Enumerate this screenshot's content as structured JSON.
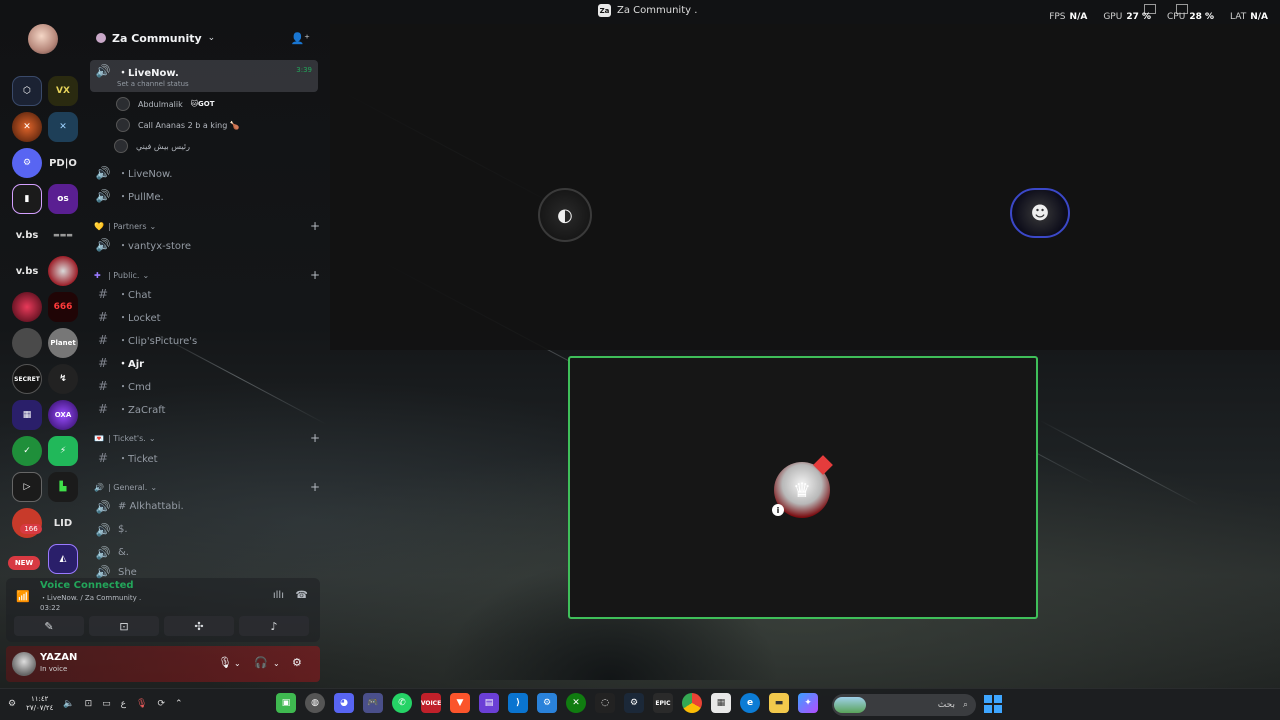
{
  "window": {
    "title": "Za Community .",
    "perf": [
      {
        "label": "FPS",
        "value": "N/A"
      },
      {
        "label": "GPU",
        "value": "27 %"
      },
      {
        "label": "CPU",
        "value": "28 %"
      },
      {
        "label": "LAT",
        "value": "N/A"
      }
    ]
  },
  "rail": {
    "new_badge": "NEW",
    "text_servers": [
      "PD|O",
      "v.bs",
      "v.bs",
      "LID"
    ],
    "badge_166": "166"
  },
  "server": {
    "name": "Za Community"
  },
  "channels": {
    "live_active": {
      "name": "・LiveNow.",
      "timer": "3:39",
      "status": "Set a channel status"
    },
    "voice_users": [
      {
        "name": "Abdulmalik",
        "tag": "🐱GOT"
      },
      {
        "name": "Call Ananas 2 b a king 🍗",
        "tag": ""
      },
      {
        "name": "رئيس بيش فيني",
        "tag": ""
      }
    ],
    "live2": "・LiveNow.",
    "pullme": "・PullMe.",
    "cat_partners": "| Partners",
    "vantyx": "・vantyx-store",
    "cat_public": "| Public.",
    "chat": "・Chat",
    "locket": "・Locket",
    "clips": "・Clip'sPicture's",
    "ajr": "・Ajr",
    "cmd": "・Cmd",
    "zacraft": "・ZaCraft",
    "cat_tickets": "| Ticket's.",
    "ticket": "・Ticket",
    "cat_general": "| General.",
    "alkhattabi": "# Alkhattabi.",
    "dollar": "$.",
    "amp": "&.",
    "she": "She"
  },
  "voice": {
    "title": "Voice Connected",
    "location": "・LiveNow. / Za Community .",
    "time": "03:22"
  },
  "user": {
    "name": "YAZAN",
    "status": "In voice"
  },
  "taskbar": {
    "time": "١١:٤٢",
    "date": "٢٧/٠٧/٢٤",
    "lang": "ع",
    "search_placeholder": "بحث"
  },
  "colors": {
    "voice_green": "#23a55a",
    "speaking_border": "#3fbf5a",
    "user_bar": "#8c181c"
  }
}
